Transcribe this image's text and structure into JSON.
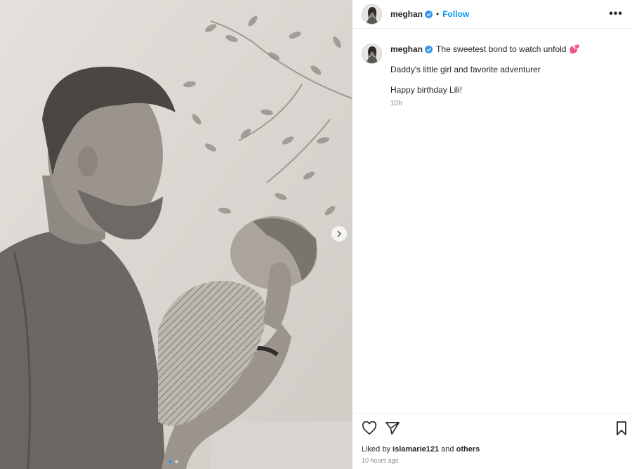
{
  "post": {
    "username": "meghan",
    "follow_label": "Follow",
    "separator": "•",
    "more_label": "•••",
    "caption_main": "The sweetest bond to watch unfold",
    "caption_emoji": "💕",
    "caption_line2": "Daddy's little girl and favorite adventurer",
    "caption_line3": "Happy birthday Lili!",
    "caption_time": "10h",
    "likes_prefix": "Liked by",
    "likes_user": "islamarie121",
    "likes_and": "and",
    "likes_others": "others",
    "posted_ago": "10 hours ago"
  },
  "carousel": {
    "total": 2,
    "current": 1
  },
  "icons": {
    "verified": "verified-badge-icon",
    "like": "heart-icon",
    "share": "paper-plane-icon",
    "save": "bookmark-icon",
    "next": "chevron-right-icon",
    "more": "ellipsis-icon"
  },
  "colors": {
    "accent": "#0095f6",
    "verified": "#3897f0",
    "text": "#262626",
    "muted": "#8e8e8e"
  }
}
